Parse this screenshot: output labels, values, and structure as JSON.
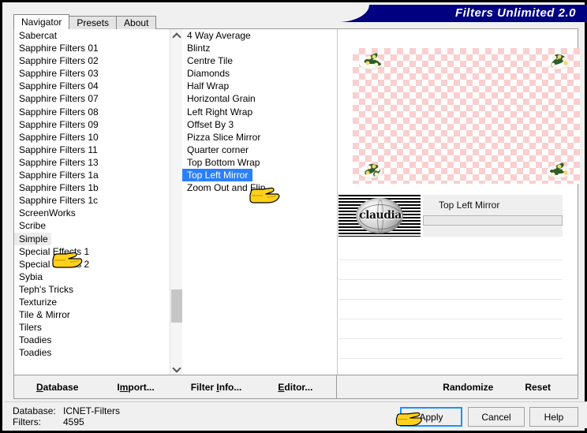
{
  "window": {
    "title": "Filters Unlimited 2.0",
    "title_color": "#000080"
  },
  "tabs": [
    {
      "label": "Navigator",
      "active": true
    },
    {
      "label": "Presets",
      "active": false
    },
    {
      "label": "About",
      "active": false
    }
  ],
  "category_list": {
    "selected": "Simple",
    "items": [
      "Sabercat",
      "Sapphire Filters 01",
      "Sapphire Filters 02",
      "Sapphire Filters 03",
      "Sapphire Filters 04",
      "Sapphire Filters 07",
      "Sapphire Filters 08",
      "Sapphire Filters 09",
      "Sapphire Filters 10",
      "Sapphire Filters 11",
      "Sapphire Filters 13",
      "Sapphire Filters 1a",
      "Sapphire Filters 1b",
      "Sapphire Filters 1c",
      "ScreenWorks",
      "Scribe",
      "Simple",
      "Special Effects 1",
      "Special Effects 2",
      "Sybia",
      "Teph's Tricks",
      "Texturize",
      "Tile & Mirror",
      "Tilers",
      "Toadies",
      "Toadies"
    ]
  },
  "filter_list": {
    "selected": "Top Left Mirror",
    "items": [
      "4 Way Average",
      "Blintz",
      "Centre Tile",
      "Diamonds",
      "Half Wrap",
      "Horizontal Grain",
      "Left Right Wrap",
      "Offset By 3",
      "Pizza Slice Mirror",
      "Quarter corner",
      "Top Bottom Wrap",
      "Top Left Mirror",
      "Zoom Out and Flip"
    ]
  },
  "preview": {
    "watermark_text": "claudia",
    "filter_name": "Top Left Mirror"
  },
  "left_buttons": [
    {
      "label": "Database",
      "accel": "D"
    },
    {
      "label": "Import...",
      "accel": "m"
    },
    {
      "label": "Filter Info...",
      "accel": "I"
    },
    {
      "label": "Editor...",
      "accel": "E"
    }
  ],
  "right_buttons": [
    {
      "label": "Randomize"
    },
    {
      "label": "Reset"
    }
  ],
  "dialog_buttons": {
    "apply": "Apply",
    "cancel": "Cancel",
    "help": "Help",
    "focus_color": "#1e90ff"
  },
  "status": {
    "database_label": "Database:",
    "database_value": "ICNET-Filters",
    "filters_label": "Filters:",
    "filters_value": "4595"
  }
}
